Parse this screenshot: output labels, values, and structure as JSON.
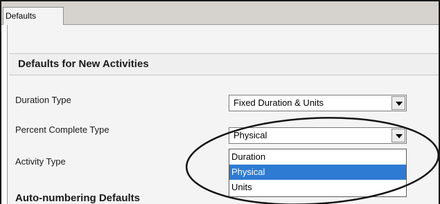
{
  "tabs": [
    {
      "label": "Defaults"
    }
  ],
  "section": {
    "title": "Defaults for New Activities"
  },
  "fields": {
    "duration_type": {
      "label": "Duration Type",
      "value": "Fixed Duration & Units"
    },
    "percent_complete_type": {
      "label": "Percent Complete Type",
      "value": "Physical"
    },
    "activity_type": {
      "label": "Activity Type"
    }
  },
  "dropdown": {
    "options": [
      "Duration",
      "Physical",
      "Units"
    ],
    "selected": "Physical"
  },
  "section2": {
    "title": "Auto-numbering Defaults"
  },
  "annotation": {
    "shape": "ellipse",
    "color": "#111111"
  },
  "colors": {
    "selection": "#2e7bd3",
    "panel_bg": "#f4f4f4",
    "tabstrip_bg": "#d6d3ce"
  }
}
